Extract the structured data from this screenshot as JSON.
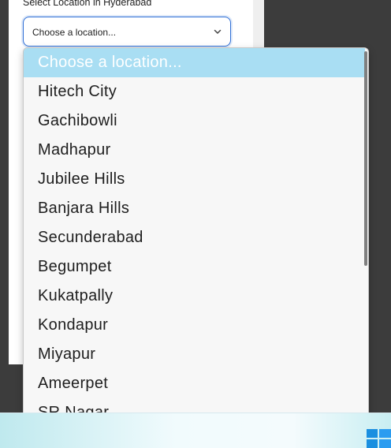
{
  "form": {
    "label": "Select Location in Hyderabad",
    "select_value": "Choose a location..."
  },
  "dropdown": {
    "options": [
      {
        "label": "Choose a location...",
        "selected": true
      },
      {
        "label": "Hitech City"
      },
      {
        "label": "Gachibowli"
      },
      {
        "label": "Madhapur"
      },
      {
        "label": "Jubilee Hills"
      },
      {
        "label": "Banjara Hills"
      },
      {
        "label": "Secunderabad"
      },
      {
        "label": "Begumpet"
      },
      {
        "label": "Kukatpally"
      },
      {
        "label": "Kondapur"
      },
      {
        "label": "Miyapur"
      },
      {
        "label": "Ameerpet"
      },
      {
        "label": "SR Nagar"
      }
    ]
  },
  "colors": {
    "selected_option_bg": "#a9def3",
    "focus_border": "#2f6fd6"
  },
  "icons": {
    "select_chevron": "chevron-down-icon",
    "taskbar_start": "windows-start-icon"
  }
}
